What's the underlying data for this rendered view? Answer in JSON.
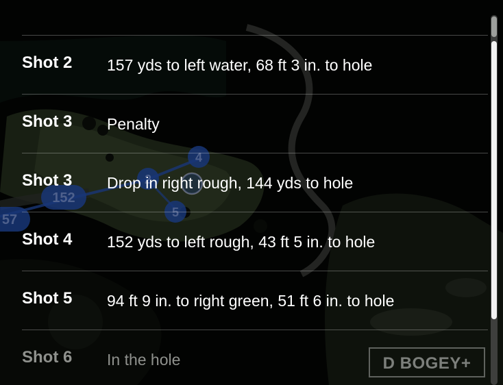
{
  "map": {
    "markers": [
      {
        "label": "152"
      },
      {
        "label": "57"
      },
      {
        "label": "2"
      },
      {
        "label": "4"
      },
      {
        "label": "5"
      }
    ]
  },
  "shots": [
    {
      "label": "Shot 2",
      "description": "157 yds to left water, 68 ft 3 in. to hole"
    },
    {
      "label": "Shot 3",
      "description": "Penalty"
    },
    {
      "label": "Shot 3",
      "description": "Drop in right rough, 144 yds to hole"
    },
    {
      "label": "Shot 4",
      "description": "152 yds to left rough, 43 ft 5 in. to hole"
    },
    {
      "label": "Shot 5",
      "description": "94 ft 9 in. to right green, 51 ft 6 in. to hole"
    },
    {
      "label": "Shot 6",
      "description": "In the hole"
    }
  ],
  "score_badge": {
    "label": "D BOGEY+"
  },
  "colors": {
    "background": "#070807",
    "text": "#ffffff",
    "faded_text": "#8f918d",
    "marker_blue": "#2d63d8",
    "badge_border": "#5f625e"
  }
}
